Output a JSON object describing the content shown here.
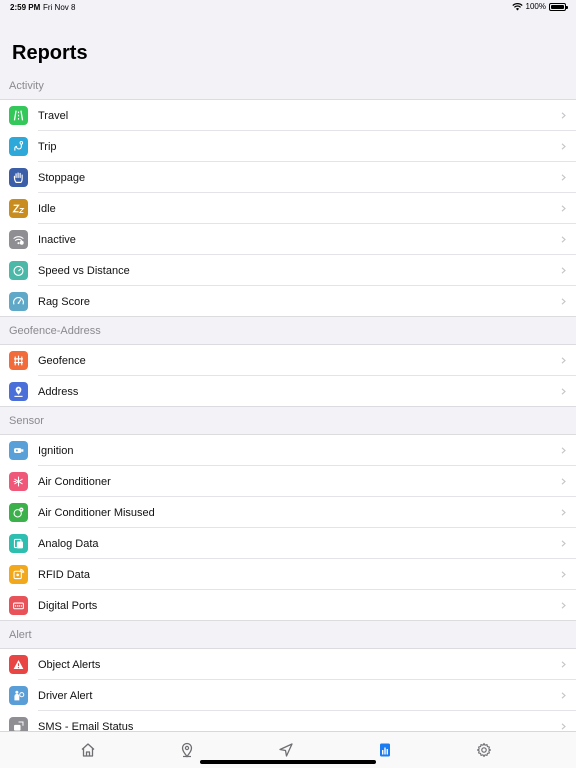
{
  "status_bar": {
    "time": "2:59 PM",
    "date": "Fri Nov 8",
    "battery": "100%"
  },
  "page": {
    "title": "Reports"
  },
  "sections": [
    {
      "header": "Activity",
      "items": [
        {
          "label": "Travel",
          "icon": "travel-road-icon",
          "color": "#34c759"
        },
        {
          "label": "Trip",
          "icon": "trip-route-icon",
          "color": "#2da8d8"
        },
        {
          "label": "Stoppage",
          "icon": "stoppage-hand-icon",
          "color": "#3a5fa8"
        },
        {
          "label": "Idle",
          "icon": "idle-zz-icon",
          "color": "#c88d1e"
        },
        {
          "label": "Inactive",
          "icon": "inactive-signal-icon",
          "color": "#8e8e93"
        },
        {
          "label": "Speed vs Distance",
          "icon": "speed-distance-icon",
          "color": "#4cb8a8"
        },
        {
          "label": "Rag Score",
          "icon": "rag-score-gauge-icon",
          "color": "#5fa8c8"
        }
      ]
    },
    {
      "header": "Geofence-Address",
      "items": [
        {
          "label": "Geofence",
          "icon": "geofence-fence-icon",
          "color": "#f26b3a"
        },
        {
          "label": "Address",
          "icon": "address-pin-icon",
          "color": "#4a6fd8"
        }
      ]
    },
    {
      "header": "Sensor",
      "items": [
        {
          "label": "Ignition",
          "icon": "ignition-key-icon",
          "color": "#5aa0d8"
        },
        {
          "label": "Air Conditioner",
          "icon": "air-conditioner-icon",
          "color": "#f0587a"
        },
        {
          "label": "Air Conditioner Misused",
          "icon": "ac-misused-icon",
          "color": "#3cb04a"
        },
        {
          "label": "Analog Data",
          "icon": "analog-data-icon",
          "color": "#2fbfb0"
        },
        {
          "label": "RFID Data",
          "icon": "rfid-card-icon",
          "color": "#f2a81d"
        },
        {
          "label": "Digital Ports",
          "icon": "digital-ports-icon",
          "color": "#e8535a"
        }
      ]
    },
    {
      "header": "Alert",
      "items": [
        {
          "label": "Object Alerts",
          "icon": "alert-warning-icon",
          "color": "#e84545"
        },
        {
          "label": "Driver Alert",
          "icon": "driver-alert-icon",
          "color": "#5a9ed8"
        },
        {
          "label": "SMS - Email Status",
          "icon": "sms-email-icon",
          "color": "#8e8e93"
        }
      ]
    }
  ],
  "tab_bar": {
    "tabs": [
      {
        "name": "home-icon",
        "active": false
      },
      {
        "name": "location-pin-icon",
        "active": false
      },
      {
        "name": "navigation-arrow-icon",
        "active": false
      },
      {
        "name": "reports-chart-icon",
        "active": true
      },
      {
        "name": "settings-gear-icon",
        "active": false
      }
    ],
    "active_color": "#1a7cf0",
    "inactive_color": "#6e6e73"
  }
}
